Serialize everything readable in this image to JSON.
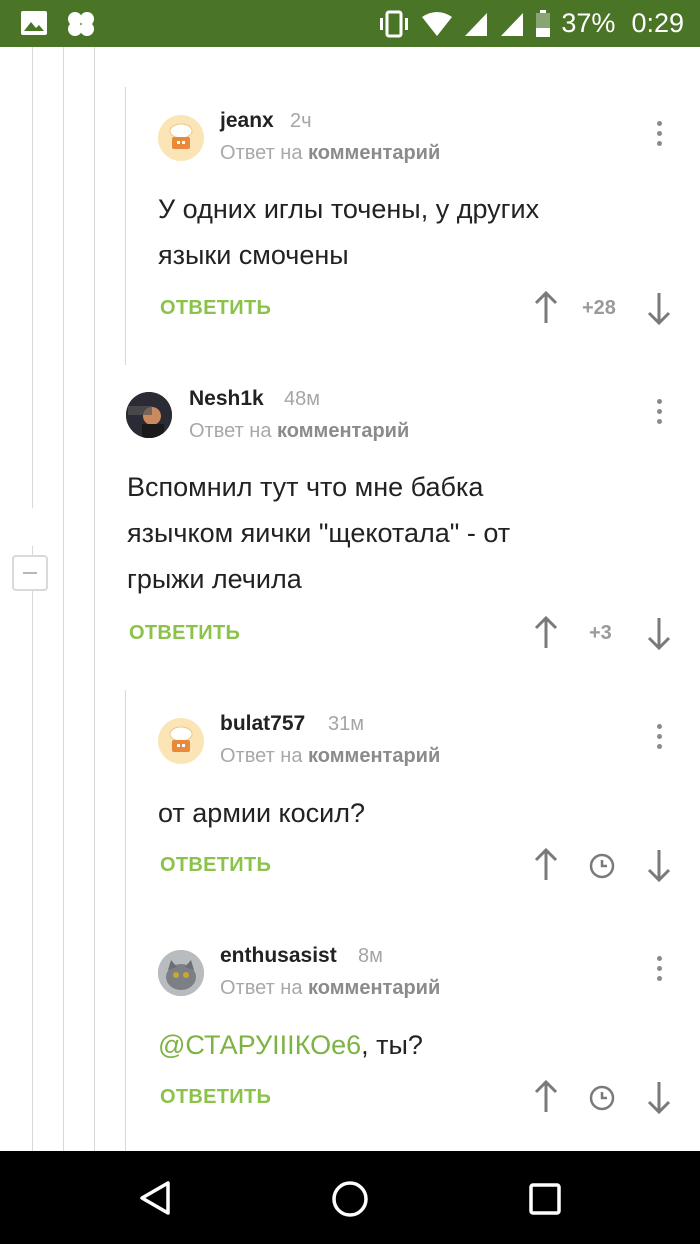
{
  "status": {
    "battery": "37%",
    "time": "0:29"
  },
  "comments": [
    {
      "author": "jeanx",
      "time": "2ч",
      "reply_prefix": "Ответ на",
      "reply_target": "комментарий",
      "text_lines": [
        "У одних иглы точены, у других",
        "языки смочены"
      ],
      "reply_label": "ОТВЕТИТЬ",
      "score": "+28"
    },
    {
      "author": "Nesh1k",
      "time": "48м",
      "reply_prefix": "Ответ на",
      "reply_target": "комментарий",
      "text_lines": [
        "Вспомнил тут что мне бабка",
        "язычком яички \"щекотала\" - от",
        "грыжи лечила"
      ],
      "reply_label": "ОТВЕТИТЬ",
      "score": "+3"
    },
    {
      "author": "bulat757",
      "time": "31м",
      "reply_prefix": "Ответ на",
      "reply_target": "комментарий",
      "text_lines": [
        "от армии косил?"
      ],
      "reply_label": "ОТВЕТИТЬ"
    },
    {
      "author": "enthusasist",
      "time": "8м",
      "reply_prefix": "Ответ на",
      "reply_target": "комментарий",
      "mention": "@СТАРУIIIКОе6",
      "text_rest": ", ты?",
      "reply_label": "ОТВЕТИТЬ"
    }
  ],
  "colors": {
    "status_bar": "#4b7526",
    "accent_green": "#8bc34a",
    "nav_bar": "#000000"
  }
}
